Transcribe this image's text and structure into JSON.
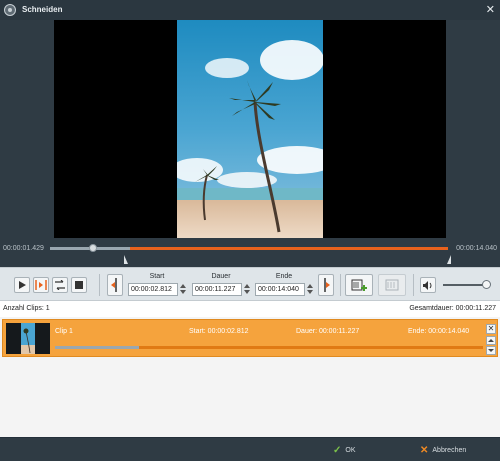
{
  "window": {
    "title": "Schneiden"
  },
  "timeline": {
    "current_time": "00:00:01.429",
    "total_time": "00:00:14.040"
  },
  "controls": {
    "start_label": "Start",
    "dauer_label": "Dauer",
    "ende_label": "Ende",
    "start_value": "00:00:02.812",
    "dauer_value": "00:00:11.227",
    "ende_value": "00:00:14:040"
  },
  "clips_header": {
    "count": "Anzahl Clips: 1",
    "total": "Gesamtdauer: 00:00:11.227"
  },
  "clips": [
    {
      "name": "Clip 1",
      "start": "Start:  00:00:02.812",
      "dauer": "Dauer:  00:00:11.227",
      "ende": "Ende:  00:00:14.040"
    }
  ],
  "footer": {
    "ok_label": "OK",
    "cancel_label": "Abbrechen"
  },
  "colors": {
    "accent": "#e8621d",
    "clip_row": "#f5a33d",
    "background": "#2f3b44",
    "ok": "#7cc24a",
    "cancel": "#f08a24"
  },
  "icons": [
    "app-icon",
    "close-icon",
    "play-icon",
    "play-selection-icon",
    "loop-icon",
    "stop-icon",
    "set-start-icon",
    "set-end-icon",
    "add-clip-icon",
    "remove-clip-icon",
    "volume-icon",
    "check-icon",
    "x-icon"
  ]
}
